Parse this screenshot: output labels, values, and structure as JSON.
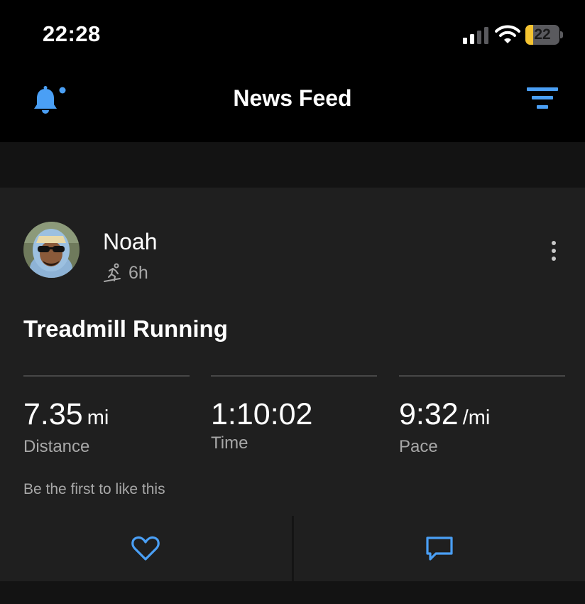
{
  "status_bar": {
    "time": "22:28",
    "battery_level": "22",
    "battery_fraction": 0.22,
    "battery_color": "#f5c431"
  },
  "nav": {
    "title": "News Feed",
    "accent_color": "#4a9ff5",
    "left_icon": "bell-icon",
    "right_icon": "filter-icon"
  },
  "post": {
    "user_name": "Noah",
    "activity_icon": "treadmill-runner-icon",
    "time_ago": "6h",
    "activity_title": "Treadmill Running",
    "stats": [
      {
        "value": "7.35",
        "unit": "mi",
        "label": "Distance"
      },
      {
        "value": "1:10:02",
        "unit": "",
        "label": "Time"
      },
      {
        "value": "9:32",
        "unit": "/mi",
        "label": "Pace"
      }
    ],
    "likes_text": "Be the first to like this"
  },
  "actions": {
    "like_icon": "heart-icon",
    "comment_icon": "comment-icon"
  }
}
